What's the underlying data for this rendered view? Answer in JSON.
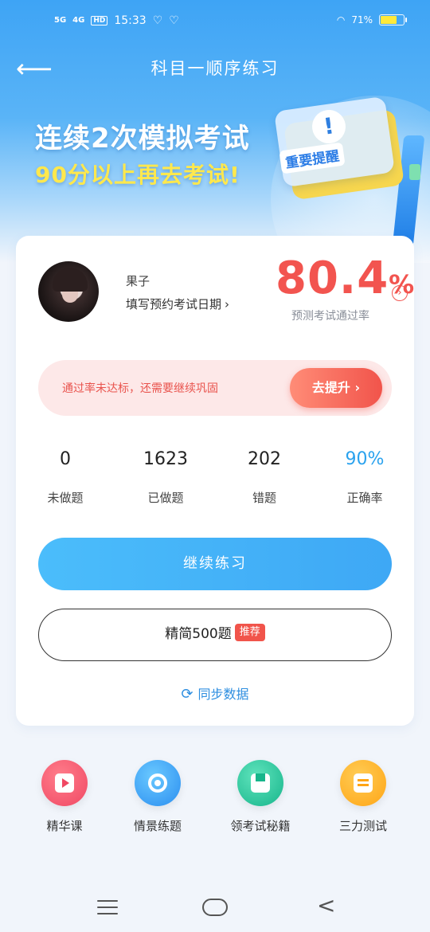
{
  "status_bar": {
    "signal_1": "5G",
    "signal_2": "4G",
    "hd": "HD",
    "time": "15:33",
    "battery": "71%",
    "battery_level": 0.71
  },
  "nav": {
    "title": "科目一顺序练习",
    "back_icon": "arrow-left-icon"
  },
  "banner": {
    "line1": "连续2次模拟考试",
    "line2": "90分以上再去考试!",
    "reminder_tag": "重要提醒",
    "reminder_mark": "!"
  },
  "profile": {
    "name": "果子",
    "exam_date_link": "填写预约考试日期",
    "exam_date_chevron": "›"
  },
  "pass_rate": {
    "value": "80.4",
    "unit": "%",
    "label": "预测考试通过率",
    "arrow": "›"
  },
  "improve": {
    "message": "通过率未达标，还需要继续巩固",
    "button": "去提升 ›"
  },
  "stats": [
    {
      "value": "0",
      "label": "未做题"
    },
    {
      "value": "1623",
      "label": "已做题"
    },
    {
      "value": "202",
      "label": "错题"
    },
    {
      "value": "90%",
      "label": "正确率"
    }
  ],
  "actions": {
    "continue": "继续练习",
    "simplified": "精简500题",
    "recommend_badge": "推荐",
    "sync": "同步数据",
    "sync_icon": "⟳"
  },
  "quick_functions": [
    {
      "label": "精华课",
      "icon": "video-icon",
      "color": "#f04863"
    },
    {
      "label": "情景练题",
      "icon": "steering-wheel-icon",
      "color": "#2b8ef0"
    },
    {
      "label": "领考试秘籍",
      "icon": "book-icon",
      "color": "#17b58b"
    },
    {
      "label": "三力测试",
      "icon": "document-icon",
      "color": "#ffa515"
    }
  ],
  "colors": {
    "accent_blue": "#3ea8f5",
    "accent_red": "#f2544f",
    "highlight_yellow": "#ffe84d"
  }
}
